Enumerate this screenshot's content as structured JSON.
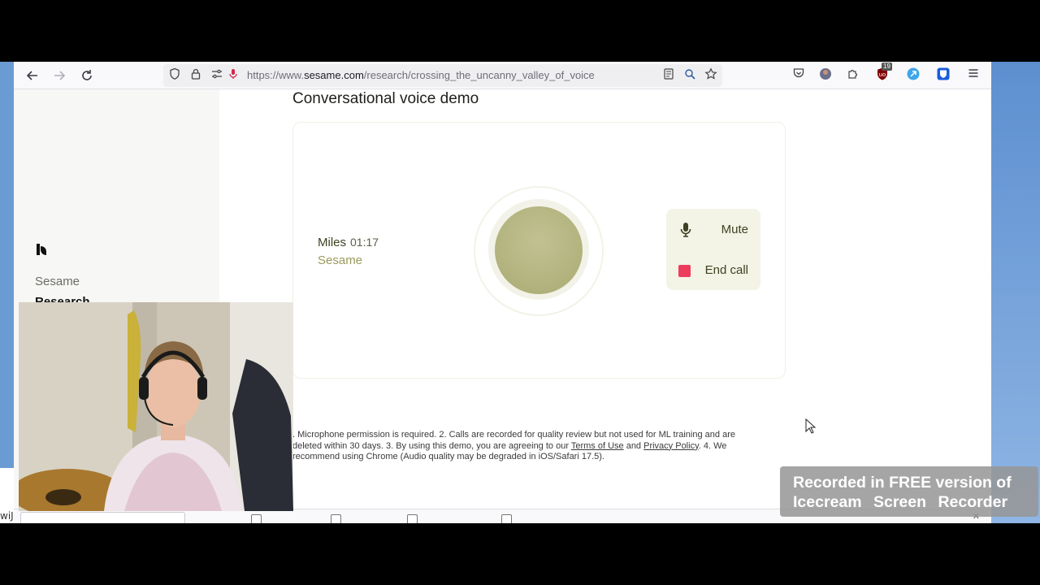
{
  "browser": {
    "url_prefix": "https://www.",
    "url_domain": "sesame.com",
    "url_path": "/research/crossing_the_uncanny_valley_of_voice",
    "extension_badge": "19",
    "nav_icons": [
      "back-arrow-icon",
      "forward-arrow-icon",
      "reload-icon"
    ],
    "url_icons": [
      "shield-icon",
      "lock-icon",
      "permissions-icon",
      "microphone-icon"
    ],
    "toolbar_icons": [
      "reader-view-icon",
      "search-page-icon",
      "star-icon",
      "pocket-icon",
      "avatar-extension-icon",
      "puzzle-icon",
      "ublock-icon",
      "cyan-extension-icon",
      "bitwarden-icon",
      "menu-icon"
    ]
  },
  "sidebar": {
    "brand": "Sesame",
    "section": "Research"
  },
  "demo": {
    "title": "Conversational voice demo",
    "caller_name": "Miles",
    "call_time": "01:17",
    "caller_org": "Sesame",
    "mute_label": "Mute",
    "end_call_label": "End call",
    "colors": {
      "orb": "#b3b47f",
      "end_call_icon": "#ee3c5d",
      "controls_bg": "#f3f3e6",
      "caller_org": "#9a9b5c"
    }
  },
  "disclaimer": {
    "part1": ". Microphone permission is required. 2. Calls are recorded for quality review but not used for ML training and are deleted within 30 days. 3. By using this demo, you are agreeing to our ",
    "terms_link": "Terms of Use",
    "and_text": " and ",
    "privacy_link": "Privacy Policy",
    "part2": ". 4. We recommend using Chrome (Audio quality may be degraded in iOS/Safari 17.5)."
  },
  "left_window": {
    "text": "wiJ"
  },
  "watermark": {
    "line1": "Recorded in FREE version of",
    "line2": "Icecream Screen Recorder"
  }
}
